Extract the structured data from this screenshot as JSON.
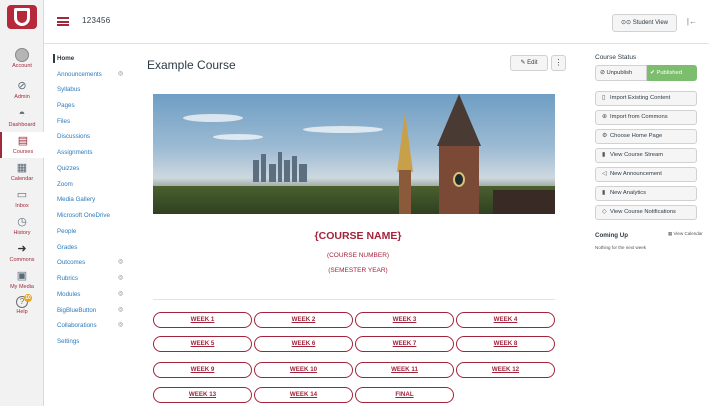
{
  "global_nav": {
    "items": [
      {
        "label": "Account",
        "icon": "avatar"
      },
      {
        "label": "Admin",
        "icon": "shield-icon"
      },
      {
        "label": "Dashboard",
        "icon": "speedometer-icon"
      },
      {
        "label": "Courses",
        "icon": "book-icon"
      },
      {
        "label": "Calendar",
        "icon": "calendar-icon"
      },
      {
        "label": "Inbox",
        "icon": "inbox-icon"
      },
      {
        "label": "History",
        "icon": "clock-icon"
      },
      {
        "label": "Commons",
        "icon": "arrow-icon"
      },
      {
        "label": "My Media",
        "icon": "media-icon"
      },
      {
        "label": "Help",
        "icon": "help-icon",
        "badge": "10"
      }
    ]
  },
  "header": {
    "breadcrumb": "123456",
    "student_view": "Student View"
  },
  "course_nav": {
    "items": [
      "Home",
      "Announcements",
      "Syllabus",
      "Pages",
      "Files",
      "Discussions",
      "Assignments",
      "Quizzes",
      "Zoom",
      "Media Gallery",
      "Microsoft OneDrive",
      "People",
      "Grades",
      "Outcomes",
      "Rubrics",
      "Modules",
      "BigBlueButton",
      "Collaborations",
      "Settings"
    ]
  },
  "main": {
    "title": "Example Course",
    "edit_label": "Edit",
    "more_label": "⋮",
    "course_name": "{COURSE NAME}",
    "course_number": "(COURSE NUMBER)",
    "semester_year": "(SEMESTER YEAR)",
    "weeks": [
      "WEEK 1",
      "WEEK 2",
      "WEEK 3",
      "WEEK 4",
      "WEEK 5",
      "WEEK 6",
      "WEEK 7",
      "WEEK 8",
      "WEEK 9",
      "WEEK 10",
      "WEEK 11",
      "WEEK 12",
      "WEEK 13",
      "WEEK 14",
      "FINAL"
    ]
  },
  "sidebar": {
    "status_title": "Course Status",
    "unpublish": "Unpublish",
    "published": "Published",
    "buttons": [
      "Import Existing Content",
      "Import from Commons",
      "Choose Home Page",
      "View Course Stream",
      "New Announcement",
      "New Analytics",
      "View Course Notifications"
    ],
    "coming_up": "Coming Up",
    "view_calendar": "View Calendar",
    "nothing": "Nothing for the next week"
  },
  "colors": {
    "brand": "#a3233a",
    "link": "#2b7abc",
    "published": "#7cbe6e"
  }
}
